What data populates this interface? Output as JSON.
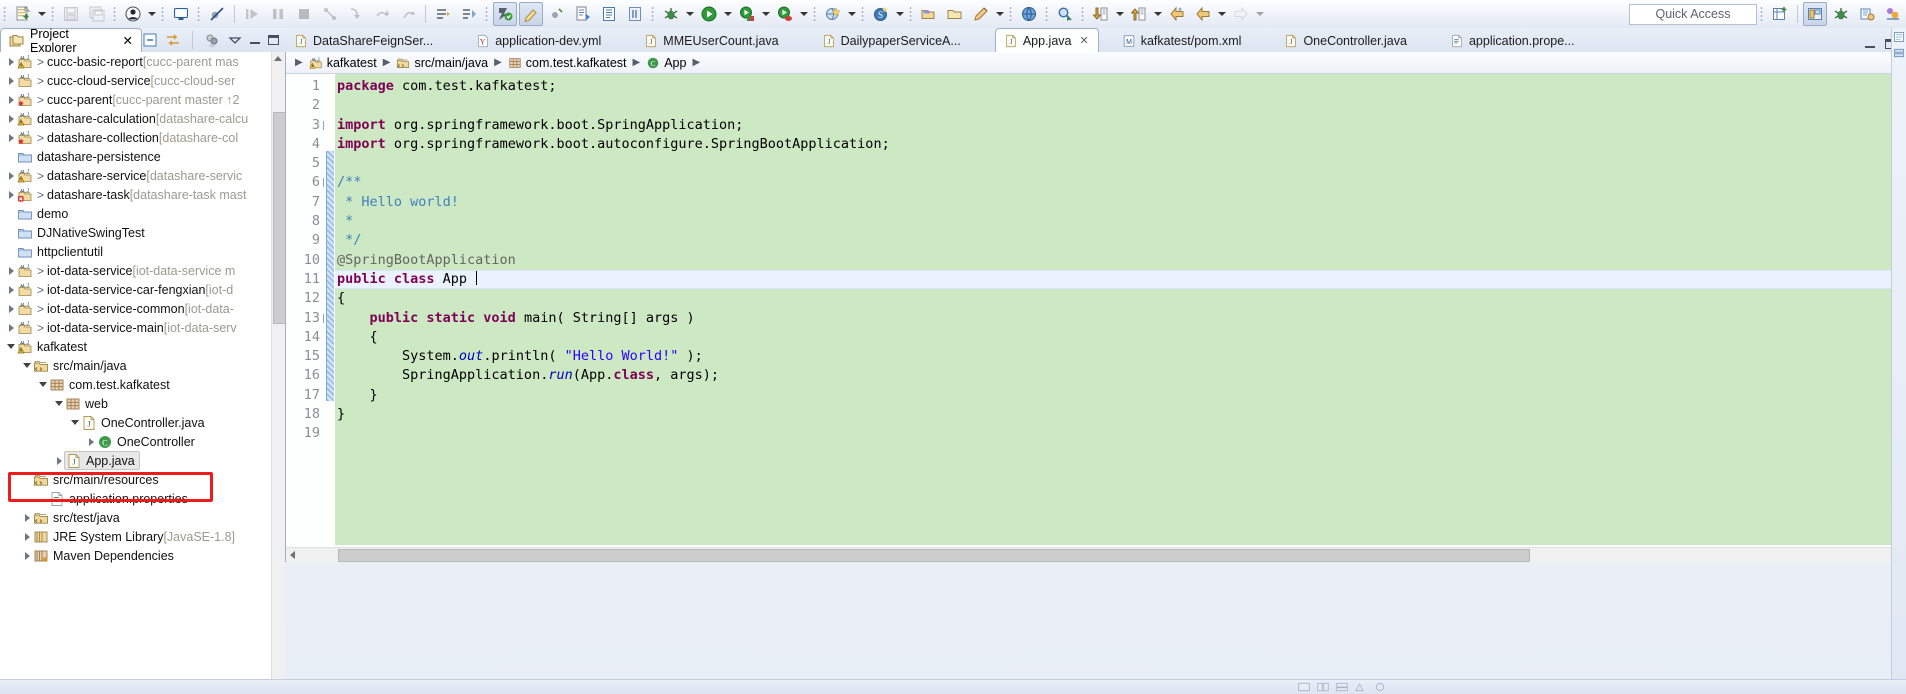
{
  "toolbar": {
    "quick_access_label": "Quick Access",
    "left_icons": [
      {
        "name": "new-wizard-icon",
        "label": "New"
      },
      {
        "name": "new-dropdown-arrow",
        "label": "New menu"
      },
      {
        "name": "save-icon",
        "label": "Save"
      },
      {
        "name": "save-all-icon",
        "label": "Save All"
      },
      {
        "name": "user-icon",
        "label": "User"
      },
      {
        "name": "user-dropdown-arrow",
        "label": "User menu"
      },
      {
        "name": "console-icon",
        "label": "Open Console"
      },
      {
        "name": "skip-breakpoints-icon",
        "label": "Skip All Breakpoints"
      },
      {
        "name": "resume-icon",
        "label": "Resume"
      },
      {
        "name": "suspend-icon",
        "label": "Suspend"
      },
      {
        "name": "terminate-icon",
        "label": "Terminate"
      },
      {
        "name": "disconnect-icon",
        "label": "Disconnect"
      },
      {
        "name": "step-into-icon",
        "label": "Step Into"
      },
      {
        "name": "step-over-icon",
        "label": "Step Over"
      },
      {
        "name": "step-return-icon",
        "label": "Step Return"
      },
      {
        "name": "toggle-mark-occurrences-icon",
        "label": "Toggle Mark Occurrences"
      },
      {
        "name": "skip-all-icon",
        "label": "Skip"
      },
      {
        "name": "java-perspective-icon",
        "label": "Java Perspective"
      },
      {
        "name": "highlight-icon",
        "label": "Highlight"
      },
      {
        "name": "coverage-icon",
        "label": "Coverage"
      },
      {
        "name": "new-java-file-icon",
        "label": "New Java File"
      },
      {
        "name": "new-class-icon",
        "label": "New Class"
      },
      {
        "name": "new-package-icon",
        "label": "New Package"
      },
      {
        "name": "debug-icon",
        "label": "Debug"
      },
      {
        "name": "debug-dropdown-arrow",
        "label": "Debug menu"
      },
      {
        "name": "run-icon",
        "label": "Run"
      },
      {
        "name": "run-dropdown-arrow",
        "label": "Run menu"
      },
      {
        "name": "run-coverage-icon",
        "label": "Coverage As"
      },
      {
        "name": "coverage-dropdown-arrow",
        "label": "Coverage menu"
      },
      {
        "name": "profile-icon",
        "label": "Profile"
      },
      {
        "name": "profile-dropdown-arrow",
        "label": "Profile menu"
      },
      {
        "name": "external-tools-icon",
        "label": "External Tools"
      },
      {
        "name": "external-dropdown-arrow",
        "label": "External Tools menu"
      },
      {
        "name": "spring-boot-icon",
        "label": "Spring Boot Dashboard"
      },
      {
        "name": "spring-dropdown-arrow",
        "label": "Spring menu"
      },
      {
        "name": "open-type-icon",
        "label": "Open Type"
      },
      {
        "name": "open-task-icon",
        "label": "Open Task"
      },
      {
        "name": "pencil-icon",
        "label": "Edit"
      },
      {
        "name": "pencil-dropdown-arrow",
        "label": "Edit menu"
      },
      {
        "name": "web-browser-icon",
        "label": "Open Web Browser"
      },
      {
        "name": "search-icon",
        "label": "Search"
      },
      {
        "name": "next-annotation-icon",
        "label": "Next Annotation"
      },
      {
        "name": "next-dropdown-arrow",
        "label": "Next menu"
      },
      {
        "name": "previous-annotation-icon",
        "label": "Previous Annotation"
      },
      {
        "name": "previous-dropdown-arrow",
        "label": "Previous menu"
      },
      {
        "name": "back-icon",
        "label": "Back"
      },
      {
        "name": "back-history-icon",
        "label": "Back History"
      },
      {
        "name": "back-dropdown-arrow",
        "label": "Back menu"
      },
      {
        "name": "forward-icon",
        "label": "Forward"
      },
      {
        "name": "forward-dropdown-arrow",
        "label": "Forward menu"
      }
    ],
    "right_icons": [
      {
        "name": "open-perspective-icon",
        "label": "Open Perspective"
      },
      {
        "name": "java-perspective-button",
        "label": "Java"
      },
      {
        "name": "debug-perspective-button",
        "label": "Debug"
      },
      {
        "name": "java-ee-perspective-button",
        "label": "Java EE"
      },
      {
        "name": "team-sync-perspective-button",
        "label": "Team Synchronizing"
      }
    ]
  },
  "explorer": {
    "title": "Project Explorer",
    "close_glyph": "✕",
    "tools": [
      {
        "name": "collapse-all-icon",
        "label": "Collapse All"
      },
      {
        "name": "link-with-editor-icon",
        "label": "Link with Editor"
      },
      {
        "name": "focus-on-active-task-icon",
        "label": "Focus on Active Task"
      },
      {
        "name": "view-menu-icon",
        "label": "View Menu"
      },
      {
        "name": "minimize-view-icon",
        "label": "Minimize"
      },
      {
        "name": "maximize-view-icon",
        "label": "Maximize"
      }
    ],
    "tree": [
      {
        "indent": 0,
        "twisty": "closed",
        "icon": "maven-project-warning-icon",
        "gt": true,
        "label": "cucc-basic-report",
        "meta": "[cucc-parent mas"
      },
      {
        "indent": 0,
        "twisty": "closed",
        "icon": "maven-project-icon",
        "gt": true,
        "label": "cucc-cloud-service",
        "meta": "[cucc-cloud-ser"
      },
      {
        "indent": 0,
        "twisty": "closed",
        "icon": "maven-project-star-icon",
        "gt": true,
        "label": "cucc-parent",
        "meta": "[cucc-parent master ↑2"
      },
      {
        "indent": 0,
        "twisty": "closed",
        "icon": "maven-project-warning-icon",
        "gt": false,
        "label": "datashare-calculation",
        "meta": "[datashare-calcu"
      },
      {
        "indent": 0,
        "twisty": "closed",
        "icon": "maven-project-star-icon",
        "gt": true,
        "label": "datashare-collection",
        "meta": "[datashare-col"
      },
      {
        "indent": 0,
        "twisty": "none",
        "icon": "folder-icon",
        "gt": false,
        "label": "datashare-persistence",
        "meta": ""
      },
      {
        "indent": 0,
        "twisty": "closed",
        "icon": "maven-project-warning-icon",
        "gt": true,
        "label": "datashare-service",
        "meta": "[datashare-servic"
      },
      {
        "indent": 0,
        "twisty": "closed",
        "icon": "maven-project-error-icon",
        "gt": true,
        "label": "datashare-task",
        "meta": "[datashare-task mast"
      },
      {
        "indent": 0,
        "twisty": "none",
        "icon": "folder-icon",
        "gt": false,
        "label": "demo",
        "meta": ""
      },
      {
        "indent": 0,
        "twisty": "none",
        "icon": "folder-icon",
        "gt": false,
        "label": "DJNativeSwingTest",
        "meta": ""
      },
      {
        "indent": 0,
        "twisty": "none",
        "icon": "folder-icon",
        "gt": false,
        "label": "httpclientutil",
        "meta": ""
      },
      {
        "indent": 0,
        "twisty": "closed",
        "icon": "maven-project-icon",
        "gt": true,
        "label": "iot-data-service",
        "meta": "[iot-data-service m"
      },
      {
        "indent": 0,
        "twisty": "closed",
        "icon": "maven-project-icon",
        "gt": true,
        "label": "iot-data-service-car-fengxian",
        "meta": "[iot-d"
      },
      {
        "indent": 0,
        "twisty": "closed",
        "icon": "maven-project-icon",
        "gt": true,
        "label": "iot-data-service-common",
        "meta": "[iot-data-"
      },
      {
        "indent": 0,
        "twisty": "closed",
        "icon": "maven-project-icon",
        "gt": true,
        "label": "iot-data-service-main",
        "meta": "[iot-data-serv"
      },
      {
        "indent": 0,
        "twisty": "open",
        "icon": "maven-project-warning-icon",
        "gt": false,
        "label": "kafkatest",
        "meta": ""
      },
      {
        "indent": 1,
        "twisty": "open",
        "icon": "source-folder-icon",
        "gt": false,
        "label": "src/main/java",
        "meta": ""
      },
      {
        "indent": 2,
        "twisty": "open",
        "icon": "package-icon",
        "gt": false,
        "label": "com.test.kafkatest",
        "meta": ""
      },
      {
        "indent": 3,
        "twisty": "open",
        "icon": "package-icon",
        "gt": false,
        "label": "web",
        "meta": ""
      },
      {
        "indent": 4,
        "twisty": "open",
        "icon": "java-file-icon",
        "gt": false,
        "label": "OneController.java",
        "meta": ""
      },
      {
        "indent": 5,
        "twisty": "closed",
        "icon": "class-icon",
        "gt": false,
        "label": "OneController",
        "meta": ""
      },
      {
        "indent": 3,
        "twisty": "closed",
        "icon": "java-file-icon",
        "gt": false,
        "label": "App.java",
        "meta": "",
        "selected": true,
        "highlighted": true
      },
      {
        "indent": 1,
        "twisty": "none",
        "icon": "source-folder-icon",
        "gt": false,
        "label": "src/main/resources",
        "meta": ""
      },
      {
        "indent": 2,
        "twisty": "none",
        "icon": "properties-file-icon",
        "gt": false,
        "label": "application.properties",
        "meta": ""
      },
      {
        "indent": 1,
        "twisty": "closed",
        "icon": "source-folder-icon",
        "gt": false,
        "label": "src/test/java",
        "meta": ""
      },
      {
        "indent": 1,
        "twisty": "closed",
        "icon": "jre-library-icon",
        "gt": false,
        "label": "JRE System Library",
        "meta": "[JavaSE-1.8]"
      },
      {
        "indent": 1,
        "twisty": "closed",
        "icon": "maven-dependencies-icon",
        "gt": false,
        "label": "Maven Dependencies",
        "meta": ""
      }
    ]
  },
  "editor_tabs": [
    {
      "label": "DataShareFeignSer...",
      "icon": "java-file-icon",
      "active": false,
      "closeable": false
    },
    {
      "label": "application-dev.yml",
      "icon": "yaml-file-icon",
      "active": false,
      "closeable": false
    },
    {
      "label": "MMEUserCount.java",
      "icon": "java-file-icon",
      "active": false,
      "closeable": false
    },
    {
      "label": "DailypaperServiceA...",
      "icon": "java-file-icon",
      "active": false,
      "closeable": false
    },
    {
      "label": "App.java",
      "icon": "java-file-icon",
      "active": true,
      "closeable": true,
      "close_glyph": "✕"
    },
    {
      "label": "kafkatest/pom.xml",
      "icon": "maven-pom-icon",
      "active": false,
      "closeable": false
    },
    {
      "label": "OneController.java",
      "icon": "java-file-icon",
      "active": false,
      "closeable": false
    },
    {
      "label": "application.prope...",
      "icon": "properties-file-icon",
      "active": false,
      "closeable": false
    }
  ],
  "breadcrumb": [
    {
      "label": "kafkatest",
      "icon": "maven-project-warning-icon"
    },
    {
      "label": "src/main/java",
      "icon": "source-folder-icon"
    },
    {
      "label": "com.test.kafkatest",
      "icon": "package-icon"
    },
    {
      "label": "App",
      "icon": "class-icon"
    }
  ],
  "code": {
    "language": "java",
    "background_color": "#cde9c3",
    "current_line": 11,
    "lines": [
      {
        "n": 1,
        "fold": false,
        "tokens": [
          {
            "t": "package ",
            "c": "kw"
          },
          {
            "t": "com.test.kafkatest;",
            "c": "plain"
          }
        ]
      },
      {
        "n": 2,
        "fold": false,
        "tokens": []
      },
      {
        "n": 3,
        "fold": true,
        "tokens": [
          {
            "t": "import ",
            "c": "kw"
          },
          {
            "t": "org.springframework.boot.SpringApplication;",
            "c": "plain"
          }
        ]
      },
      {
        "n": 4,
        "fold": false,
        "tokens": [
          {
            "t": "import ",
            "c": "kw"
          },
          {
            "t": "org.springframework.boot.autoconfigure.SpringBootApplication;",
            "c": "plain"
          }
        ]
      },
      {
        "n": 5,
        "fold": false,
        "tokens": []
      },
      {
        "n": 6,
        "fold": true,
        "tokens": [
          {
            "t": "/**",
            "c": "cmt"
          }
        ]
      },
      {
        "n": 7,
        "fold": false,
        "tokens": [
          {
            "t": " * Hello world!",
            "c": "cmt"
          }
        ]
      },
      {
        "n": 8,
        "fold": false,
        "tokens": [
          {
            "t": " *",
            "c": "cmt"
          }
        ]
      },
      {
        "n": 9,
        "fold": false,
        "tokens": [
          {
            "t": " */",
            "c": "cmt"
          }
        ]
      },
      {
        "n": 10,
        "fold": false,
        "tokens": [
          {
            "t": "@SpringBootApplication",
            "c": "ann"
          }
        ]
      },
      {
        "n": 11,
        "fold": false,
        "current": true,
        "caret": true,
        "tokens": [
          {
            "t": "public class ",
            "c": "kw"
          },
          {
            "t": "App ",
            "c": "plain"
          }
        ]
      },
      {
        "n": 12,
        "fold": false,
        "tokens": [
          {
            "t": "{",
            "c": "plain"
          }
        ]
      },
      {
        "n": 13,
        "fold": true,
        "tokens": [
          {
            "t": "    ",
            "c": "plain"
          },
          {
            "t": "public static void ",
            "c": "kw"
          },
          {
            "t": "main( String[] args )",
            "c": "plain"
          }
        ]
      },
      {
        "n": 14,
        "fold": false,
        "tokens": [
          {
            "t": "    {",
            "c": "plain"
          }
        ]
      },
      {
        "n": 15,
        "fold": false,
        "tokens": [
          {
            "t": "        System.",
            "c": "plain"
          },
          {
            "t": "out",
            "c": "stat"
          },
          {
            "t": ".println( ",
            "c": "plain"
          },
          {
            "t": "\"Hello World!\"",
            "c": "str"
          },
          {
            "t": " );",
            "c": "plain"
          }
        ]
      },
      {
        "n": 16,
        "fold": false,
        "tokens": [
          {
            "t": "        SpringApplication.",
            "c": "plain"
          },
          {
            "t": "run",
            "c": "stat"
          },
          {
            "t": "(App.",
            "c": "plain"
          },
          {
            "t": "class",
            "c": "kw"
          },
          {
            "t": ", args);",
            "c": "plain"
          }
        ]
      },
      {
        "n": 17,
        "fold": false,
        "tokens": [
          {
            "t": "    }",
            "c": "plain"
          }
        ]
      },
      {
        "n": 18,
        "fold": false,
        "tokens": [
          {
            "t": "}",
            "c": "plain"
          }
        ]
      },
      {
        "n": 19,
        "fold": false,
        "tokens": []
      }
    ]
  },
  "annotation": {
    "highlight_color": "#ee1c1c",
    "target": "App.java"
  }
}
